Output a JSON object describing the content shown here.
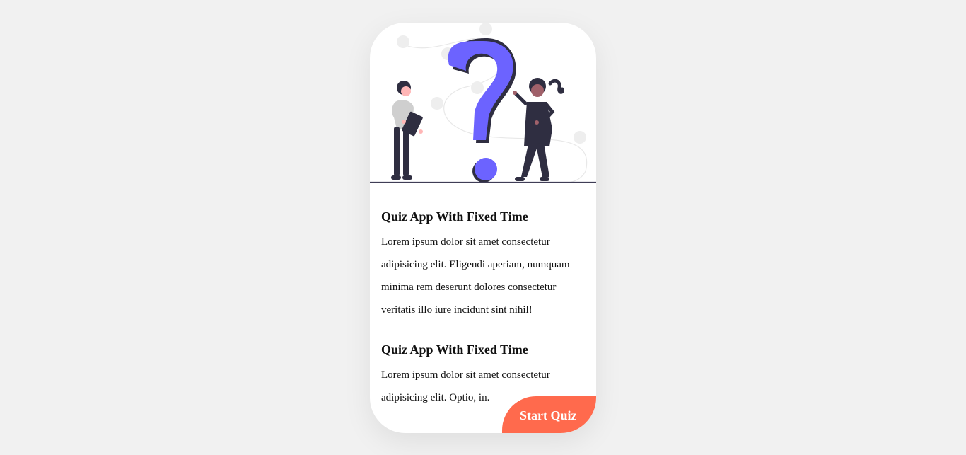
{
  "illustration": {
    "name": "quiz-question-illustration",
    "accent_color": "#6c63ff",
    "dark_color": "#2f2e41"
  },
  "sections": [
    {
      "title": "Quiz App With Fixed Time",
      "body": "Lorem ipsum dolor sit amet consectetur adipisicing elit. Eligendi aperiam, numquam minima rem deserunt dolores consectetur veritatis illo iure incidunt sint nihil!"
    },
    {
      "title": "Quiz App With Fixed Time",
      "body": "Lorem ipsum dolor sit amet consectetur adipisicing elit. Optio, in."
    }
  ],
  "start_button": {
    "label": "Start Quiz",
    "color": "#ff6a4d"
  }
}
